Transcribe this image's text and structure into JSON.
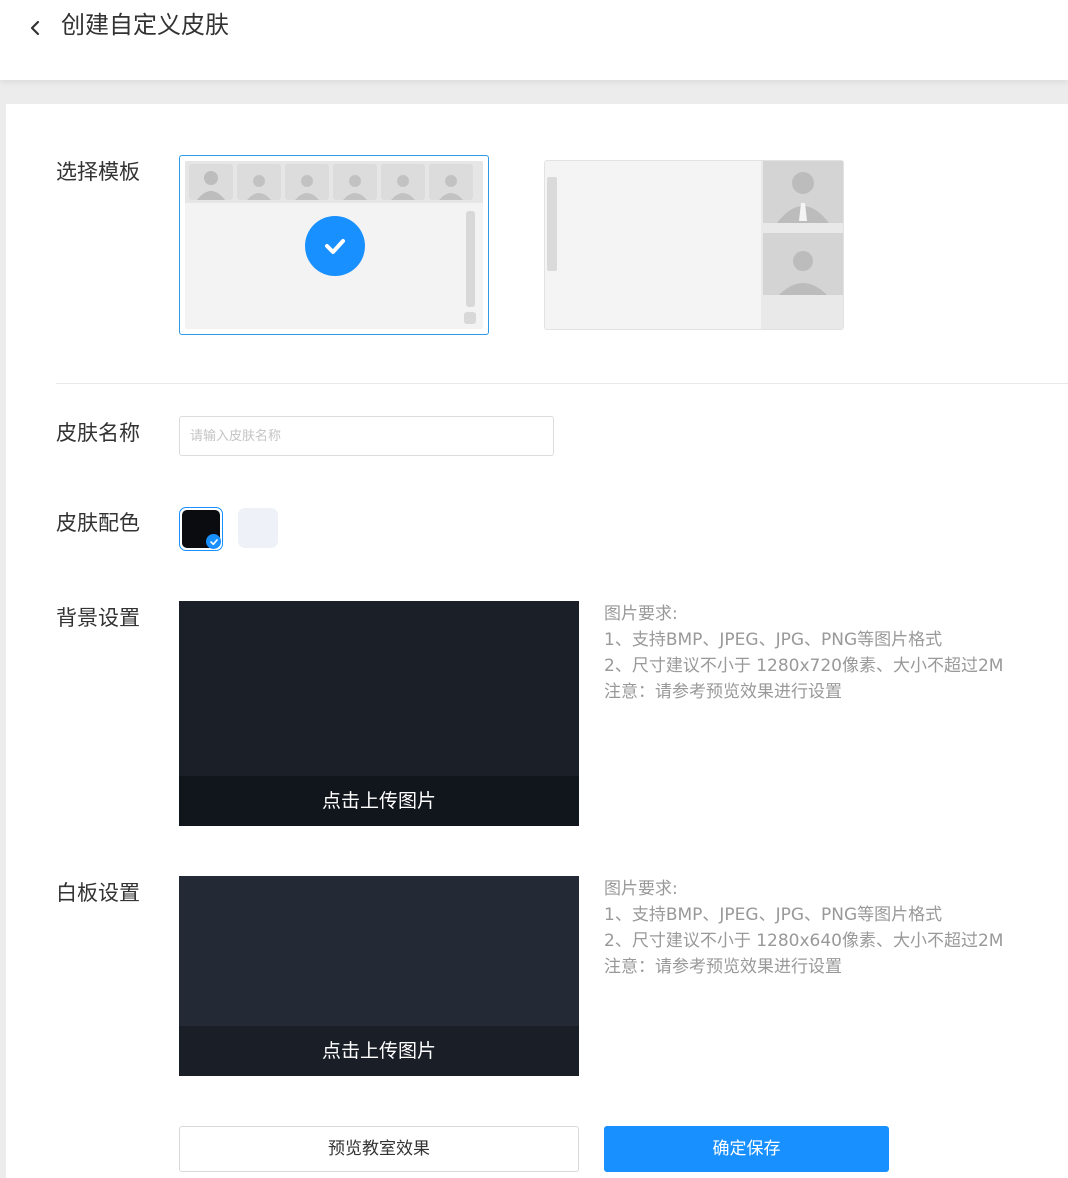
{
  "header": {
    "title": "创建自定义皮肤",
    "back_icon": "chevron-left-icon"
  },
  "form": {
    "template_label": "选择模板",
    "name_label": "皮肤名称",
    "name_placeholder": "请输入皮肤名称",
    "name_value": "",
    "color_label": "皮肤配色",
    "background_label": "背景设置",
    "whiteboard_label": "白板设置"
  },
  "templates": [
    {
      "id": "template-1",
      "selected": true
    },
    {
      "id": "template-2",
      "selected": false
    }
  ],
  "colors": {
    "options": [
      "#0b0c0f",
      "#eef1f8"
    ],
    "selected": "#0b0c0f",
    "accent": "#1890ff"
  },
  "background_upload": {
    "caption": "点击上传图片",
    "requirements": [
      "图片要求:",
      "1、支持BMP、JPEG、JPG、PNG等图片格式",
      "2、尺寸建议不小于 1280x720像素、大小不超过2M",
      "注意：请参考预览效果进行设置"
    ]
  },
  "whiteboard_upload": {
    "caption": "点击上传图片",
    "requirements": [
      "图片要求:",
      "1、支持BMP、JPEG、JPG、PNG等图片格式",
      "2、尺寸建议不小于 1280x640像素、大小不超过2M",
      "注意：请参考预览效果进行设置"
    ]
  },
  "actions": {
    "preview_label": "预览教室效果",
    "save_label": "确定保存"
  }
}
